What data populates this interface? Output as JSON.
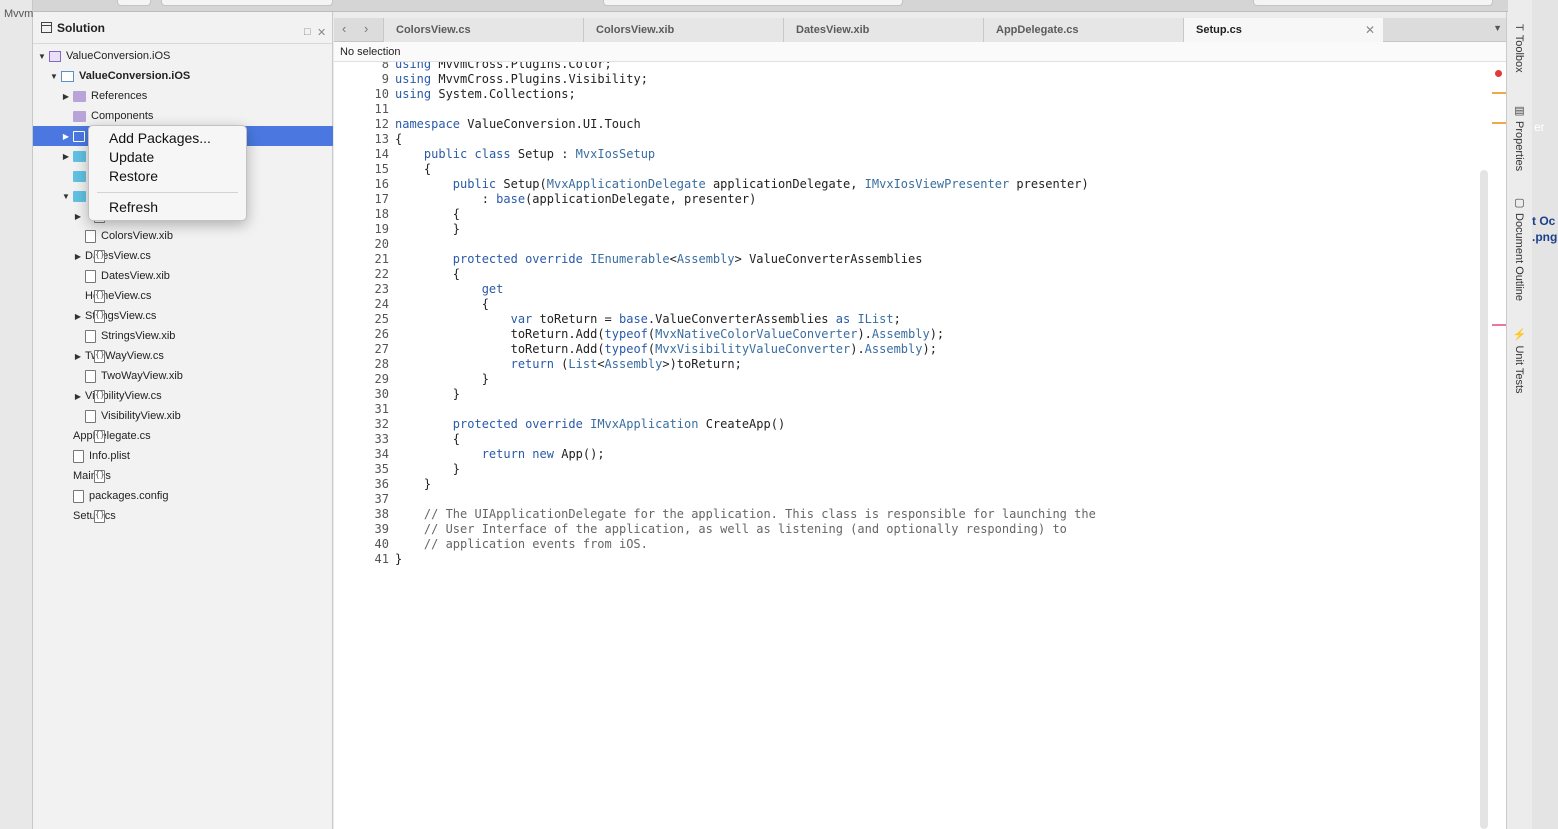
{
  "desktop": {
    "left_label": "Mvvm",
    "right_fragments": [
      "er",
      "t Oc",
      ".png"
    ]
  },
  "solution_pad": {
    "title": "Solution",
    "items": [
      {
        "label": "ValueConversion.iOS",
        "icon": "solution-icon",
        "expand": "open"
      },
      {
        "label": "ValueConversion.iOS",
        "icon": "project-icon",
        "expand": "open",
        "bold": true
      },
      {
        "label": "References",
        "icon": "references-folder-icon",
        "expand": "closed"
      },
      {
        "label": "Components",
        "icon": "components-folder-icon",
        "expand": "none"
      },
      {
        "label": "",
        "icon": "packages-folder-icon",
        "expand": "closed",
        "selected": true
      },
      {
        "label": "",
        "icon": "folder-icon",
        "expand": "closed"
      },
      {
        "label": "",
        "icon": "folder-icon",
        "expand": "none"
      },
      {
        "label": "",
        "icon": "folder-icon",
        "expand": "open"
      },
      {
        "label": "",
        "icon": "code-file-icon",
        "expand": "closed"
      },
      {
        "label": "ColorsView.xib",
        "icon": "xib-file-icon",
        "expand": "none"
      },
      {
        "label": "DatesView.cs",
        "icon": "code-file-icon",
        "expand": "closed"
      },
      {
        "label": "DatesView.xib",
        "icon": "xib-file-icon",
        "expand": "none"
      },
      {
        "label": "HomeView.cs",
        "icon": "code-file-icon",
        "expand": "none"
      },
      {
        "label": "StringsView.cs",
        "icon": "code-file-icon",
        "expand": "closed"
      },
      {
        "label": "StringsView.xib",
        "icon": "xib-file-icon",
        "expand": "none"
      },
      {
        "label": "TwoWayView.cs",
        "icon": "code-file-icon",
        "expand": "closed"
      },
      {
        "label": "TwoWayView.xib",
        "icon": "xib-file-icon",
        "expand": "none"
      },
      {
        "label": "VisibilityView.cs",
        "icon": "code-file-icon",
        "expand": "closed"
      },
      {
        "label": "VisibilityView.xib",
        "icon": "xib-file-icon",
        "expand": "none"
      },
      {
        "label": "AppDelegate.cs",
        "icon": "code-file-icon",
        "expand": "none"
      },
      {
        "label": "Info.plist",
        "icon": "plist-file-icon",
        "expand": "none"
      },
      {
        "label": "Main.cs",
        "icon": "code-file-icon",
        "expand": "none"
      },
      {
        "label": "packages.config",
        "icon": "config-file-icon",
        "expand": "none"
      },
      {
        "label": "Setup.cs",
        "icon": "code-file-icon",
        "expand": "none"
      }
    ]
  },
  "context_menu": {
    "items": [
      "Add Packages...",
      "Update",
      "Restore",
      "Refresh"
    ]
  },
  "tabs": [
    "ColorsView.cs",
    "ColorsView.xib",
    "DatesView.xib",
    "AppDelegate.cs",
    "Setup.cs"
  ],
  "active_tab": "Setup.cs",
  "selection_bar": "No selection",
  "code_lines": [
    {
      "n": "9",
      "t": "using MvvmCross.Plugins.Visibility;"
    },
    {
      "n": "10",
      "t": "using System.Collections;"
    },
    {
      "n": "11",
      "t": ""
    },
    {
      "n": "12",
      "t": "namespace ValueConversion.UI.Touch"
    },
    {
      "n": "13",
      "t": "{"
    },
    {
      "n": "14",
      "t": "    public class Setup : MvxIosSetup"
    },
    {
      "n": "15",
      "t": "    {"
    },
    {
      "n": "16",
      "t": "        public Setup(MvxApplicationDelegate applicationDelegate, IMvxIosViewPresenter presenter)"
    },
    {
      "n": "17",
      "t": "            : base(applicationDelegate, presenter)"
    },
    {
      "n": "18",
      "t": "        {"
    },
    {
      "n": "19",
      "t": "        }"
    },
    {
      "n": "20",
      "t": ""
    },
    {
      "n": "21",
      "t": "        protected override IEnumerable<Assembly> ValueConverterAssemblies"
    },
    {
      "n": "22",
      "t": "        {"
    },
    {
      "n": "23",
      "t": "            get"
    },
    {
      "n": "24",
      "t": "            {"
    },
    {
      "n": "25",
      "t": "                var toReturn = base.ValueConverterAssemblies as IList;"
    },
    {
      "n": "26",
      "t": "                toReturn.Add(typeof(MvxNativeColorValueConverter).Assembly);"
    },
    {
      "n": "27",
      "t": "                toReturn.Add(typeof(MvxVisibilityValueConverter).Assembly);"
    },
    {
      "n": "28",
      "t": "                return (List<Assembly>)toReturn;"
    },
    {
      "n": "29",
      "t": "            }"
    },
    {
      "n": "30",
      "t": "        }"
    },
    {
      "n": "31",
      "t": ""
    },
    {
      "n": "32",
      "t": "        protected override IMvxApplication CreateApp()"
    },
    {
      "n": "33",
      "t": "        {"
    },
    {
      "n": "34",
      "t": "            return new App();"
    },
    {
      "n": "35",
      "t": "        }"
    },
    {
      "n": "36",
      "t": "    }"
    },
    {
      "n": "37",
      "t": ""
    },
    {
      "n": "38",
      "t": "    // The UIApplicationDelegate for the application. This class is responsible for launching the"
    },
    {
      "n": "39",
      "t": "    // User Interface of the application, as well as listening (and optionally responding) to"
    },
    {
      "n": "40",
      "t": "    // application events from iOS."
    },
    {
      "n": "41",
      "t": "}"
    }
  ],
  "right_dock": {
    "items": [
      {
        "label": "Toolbox",
        "icon": "toolbox-icon"
      },
      {
        "label": "Properties",
        "icon": "properties-icon"
      },
      {
        "label": "Document Outline",
        "icon": "document-outline-icon"
      },
      {
        "label": "Unit Tests",
        "icon": "unit-tests-icon"
      }
    ]
  }
}
